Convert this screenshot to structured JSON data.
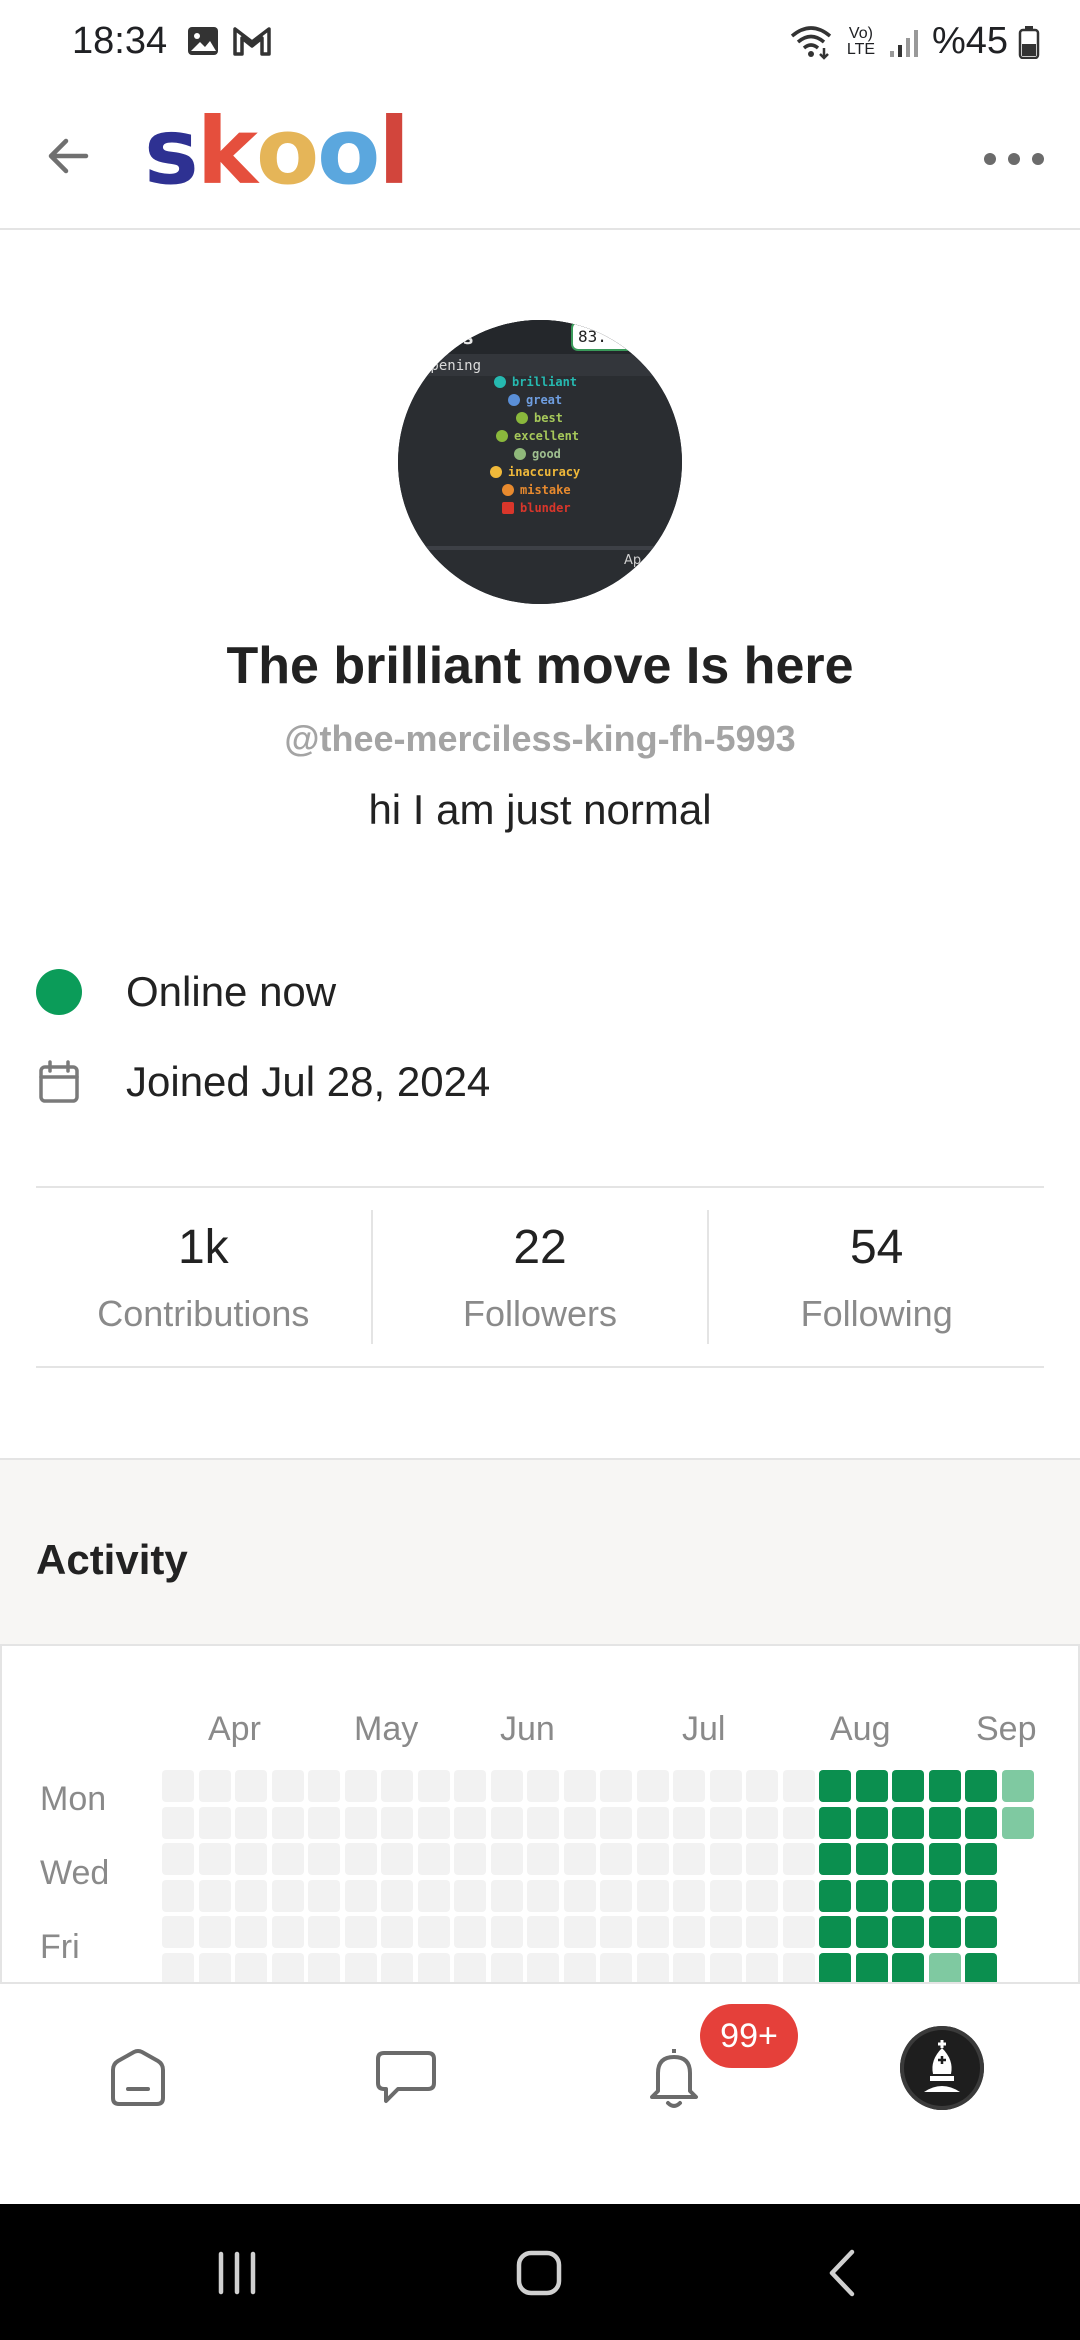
{
  "status_bar": {
    "time": "18:34",
    "battery": "%45",
    "network": "Vo) LTE"
  },
  "header": {
    "logo_letters": [
      "s",
      "k",
      "o",
      "o",
      "l"
    ],
    "logo_colors": [
      "#2e3192",
      "#e54f3d",
      "#e5b558",
      "#5ba7de",
      "#d2453c"
    ]
  },
  "profile": {
    "avatar_image_lines": [
      "ies",
      "83.",
      "Opening",
      "brilliant",
      "great",
      "best",
      "excellent",
      "good",
      "inaccuracy",
      "mistake",
      "blunder",
      "Ap"
    ],
    "name": "The brilliant move Is here",
    "handle": "@thee-merciless-king-fh-5993",
    "bio": "hi I am just normal",
    "status": "Online now",
    "joined": "Joined Jul 28, 2024"
  },
  "stats": [
    {
      "value": "1k",
      "label": "Contributions"
    },
    {
      "value": "22",
      "label": "Followers"
    },
    {
      "value": "54",
      "label": "Following"
    }
  ],
  "activity": {
    "title": "Activity",
    "months": [
      "Apr",
      "May",
      "Jun",
      "Jul",
      "Aug",
      "Sep"
    ],
    "day_labels": [
      "Mon",
      "Wed",
      "Fri"
    ],
    "colors": {
      "empty": "#f2f2f2",
      "high": "#0b8f4f",
      "low": "#7fc9a1"
    }
  },
  "bottom_nav": {
    "badge": "99+",
    "items": [
      "home-icon",
      "chat-icon",
      "bell-icon",
      "profile-avatar"
    ]
  }
}
